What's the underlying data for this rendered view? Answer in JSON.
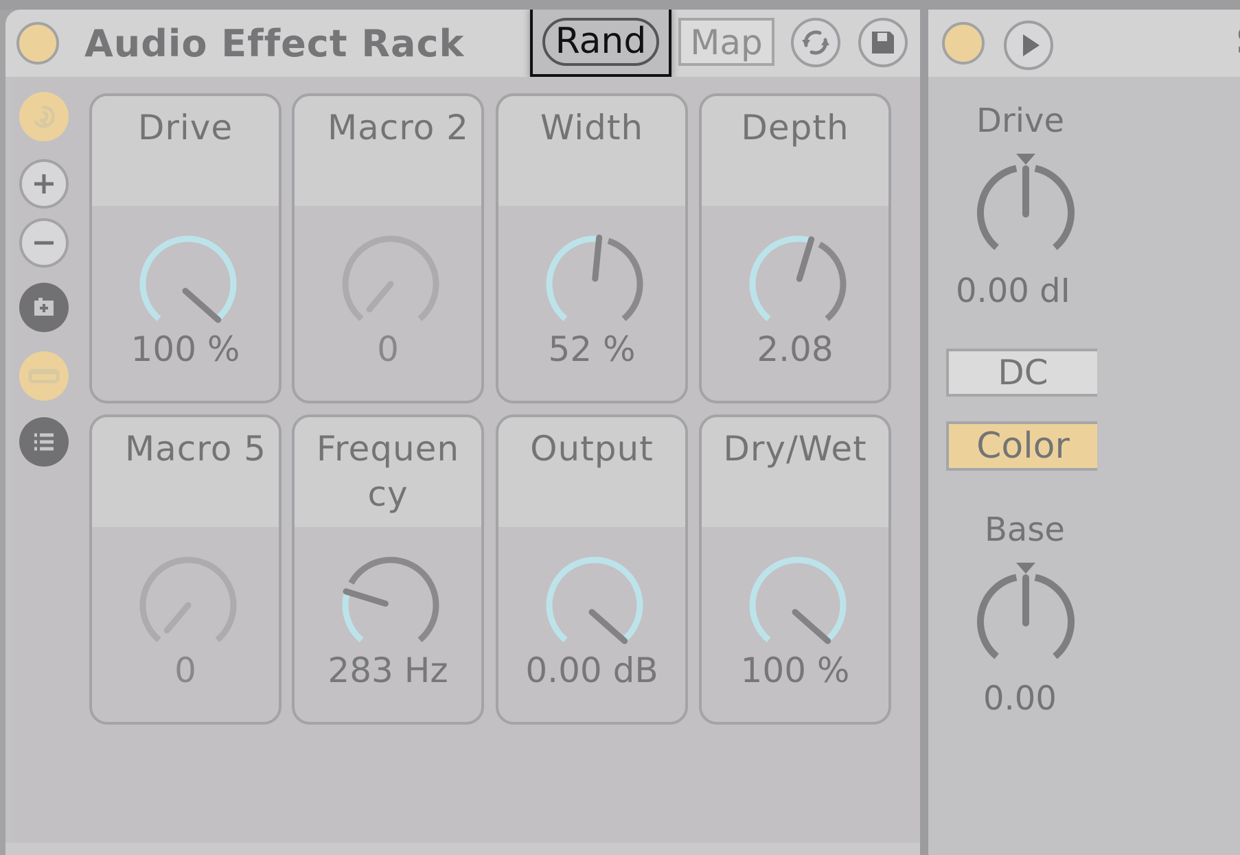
{
  "rack": {
    "title": "Audio Effect Rack",
    "buttons": {
      "rand_label": "Rand",
      "map_label": "Map",
      "sync_icon": "refresh-arrows-icon",
      "save_icon": "floppy-save-icon"
    },
    "sidebar": [
      {
        "icon": "macro-variations-icon",
        "state": "active"
      },
      {
        "icon": "plus-icon",
        "state": "normal"
      },
      {
        "icon": "minus-icon",
        "state": "normal"
      },
      {
        "icon": "add-chain-icon",
        "state": "dark"
      },
      {
        "icon": "macro-view-icon",
        "state": "active"
      },
      {
        "icon": "chain-list-icon",
        "state": "dark"
      }
    ],
    "macros": [
      {
        "name": "Drive",
        "value": "100 %",
        "fraction": 1.0,
        "mapped": true
      },
      {
        "name": "Macro 2",
        "value": "0",
        "fraction": 0.0,
        "mapped": false
      },
      {
        "name": "Width",
        "value": "52 %",
        "fraction": 0.52,
        "mapped": true
      },
      {
        "name": "Depth",
        "value": "2.08",
        "fraction": 0.56,
        "mapped": true
      },
      {
        "name": "Macro 5",
        "value": "0",
        "fraction": 0.0,
        "mapped": false
      },
      {
        "name": "Frequency",
        "name_lines": [
          "Frequen",
          "cy"
        ],
        "value": "283 Hz",
        "fraction": 0.24,
        "mapped": true
      },
      {
        "name": "Output",
        "value": "0.00 dB",
        "fraction": 1.0,
        "mapped": true
      },
      {
        "name": "Dry/Wet",
        "value": "100 %",
        "fraction": 1.0,
        "mapped": true
      }
    ]
  },
  "device2": {
    "title_partial": "S",
    "drive_label": "Drive",
    "drive_value": "0.00 dI",
    "dc_label": "DC",
    "color_label": "Color",
    "base_label": "Base",
    "base_value": "0.00",
    "drive_fraction": 0.5,
    "base_fraction": 0.5
  },
  "colors": {
    "accent_yellow": "#ecd29a",
    "knob_active_arc": "#bde3ea",
    "knob_track": "#8a898c",
    "text": "#747476"
  }
}
